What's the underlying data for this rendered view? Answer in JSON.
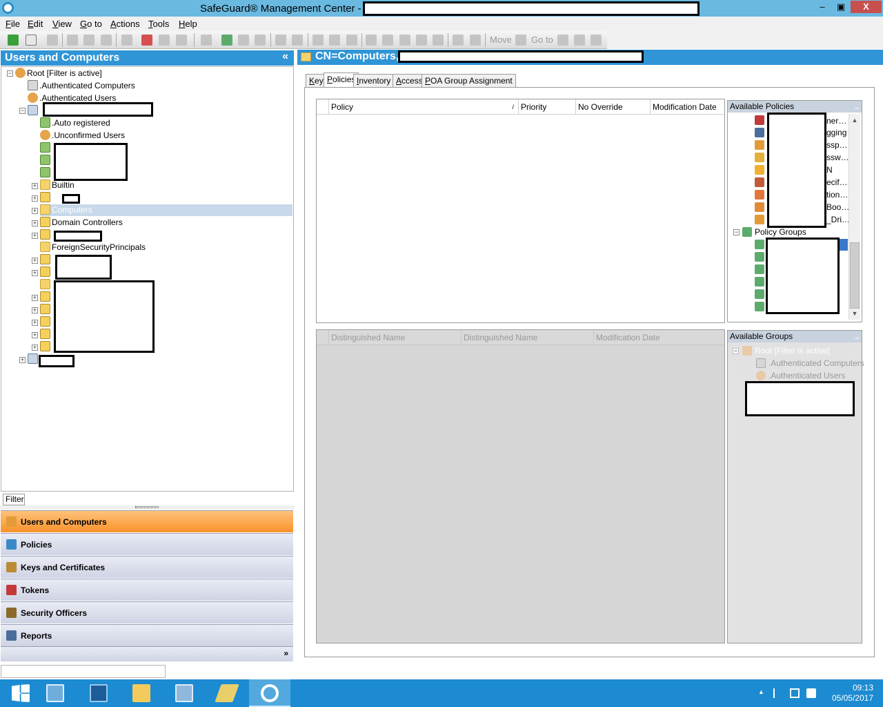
{
  "window": {
    "title": "SafeGuard® Management Center -",
    "minimize": "–",
    "maximize": "▣",
    "close": "X"
  },
  "menu": [
    "File",
    "Edit",
    "View",
    "Go to",
    "Actions",
    "Tools",
    "Help"
  ],
  "toolbar": {
    "move_label": "Move",
    "goto_label": "Go to"
  },
  "left_pane": {
    "title": "Users and Computers",
    "collapse_icon": "«",
    "tree": {
      "root": "Root [Filter is active]",
      "auth_computers": ".Authenticated Computers",
      "auth_users": ".Authenticated Users",
      "auto_registered": ".Auto registered",
      "unconfirmed_users": ".Unconfirmed Users",
      "builtin": "Builtin",
      "computers": "Computers",
      "domain_controllers": "Domain Controllers",
      "foreign": "ForeignSecurityPrincipals"
    },
    "filter_tab": "Filter"
  },
  "nav": [
    {
      "label": "Users and Computers",
      "icon": "users-computers-icon",
      "color": "#e39b3a"
    },
    {
      "label": "Policies",
      "icon": "policies-icon",
      "color": "#3a8ac9"
    },
    {
      "label": "Keys and Certificates",
      "icon": "keys-icon",
      "color": "#b98c35"
    },
    {
      "label": "Tokens",
      "icon": "tokens-icon",
      "color": "#c23a3a"
    },
    {
      "label": "Security Officers",
      "icon": "security-officer-icon",
      "color": "#8a6a2a"
    },
    {
      "label": "Reports",
      "icon": "reports-icon",
      "color": "#4b6d9b"
    }
  ],
  "nav_more": "»",
  "right_pane": {
    "title": "CN=Computers,",
    "tabs": [
      "Key",
      "Policies",
      "Inventory",
      "Access",
      "POA Group Assignment"
    ],
    "active_tab": "Policies",
    "policy_columns": [
      "Policy",
      "Priority",
      "No Override",
      "Modification Date"
    ],
    "dn_columns": [
      "Distinguished Name",
      "Distinguished Name",
      "Modification Date"
    ],
    "available_policies": {
      "title": "Available Policies",
      "pin": "⨼",
      "partial_items": [
        "ner…",
        "gging",
        "ssp…",
        "ssw…",
        "N",
        "ecif…",
        "tion…",
        "Boo…",
        "_Dri…"
      ],
      "policy_groups": "Policy Groups"
    },
    "available_groups": {
      "title": "Available Groups",
      "pin": "⨼",
      "root": "Root [Filter is active]",
      "auth_computers": ".Authenticated Computers",
      "auth_users": ".Authenticated Users"
    }
  },
  "taskbar": {
    "time": "09:13",
    "date": "05/05/2017"
  }
}
